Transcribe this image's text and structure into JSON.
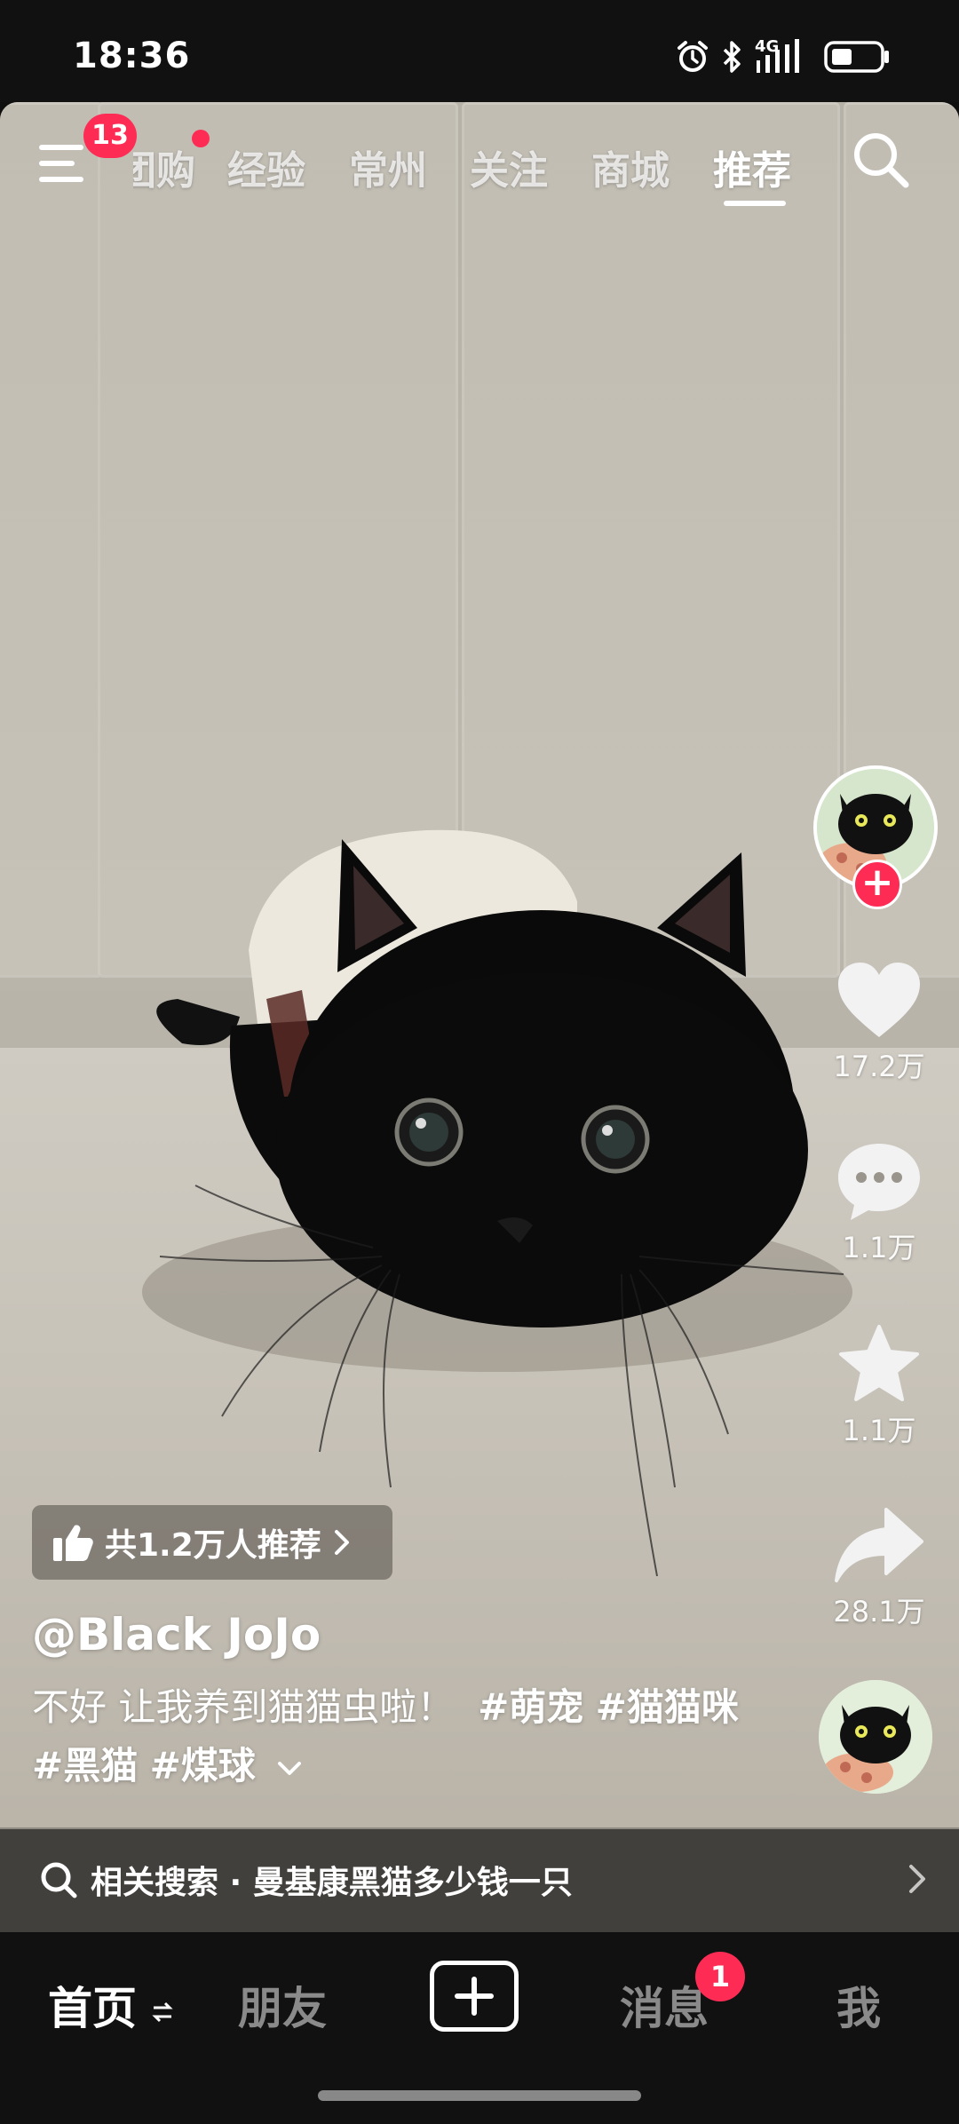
{
  "status_bar": {
    "time": "18:36",
    "network": "4G"
  },
  "top_nav": {
    "menu_badge": "13",
    "tabs": [
      {
        "label": "团购",
        "active": false
      },
      {
        "label": "经验",
        "active": false
      },
      {
        "label": "常州",
        "active": false
      },
      {
        "label": "关注",
        "active": false
      },
      {
        "label": "商城",
        "active": false
      },
      {
        "label": "推荐",
        "active": true
      }
    ]
  },
  "right_rail": {
    "likes": "17.2万",
    "comments": "1.1万",
    "favorites": "1.1万",
    "shares": "28.1万",
    "follow_symbol": "+"
  },
  "video": {
    "recommend_text": "共1.2万人推荐",
    "author": "@Black JoJo",
    "description": "不好 让我养到猫猫虫啦！",
    "hashtags": [
      "#萌宠",
      "#猫猫咪",
      "#黑猫",
      "#煤球"
    ]
  },
  "related_search": {
    "text": "相关搜索 · 曼基康黑猫多少钱一只"
  },
  "bottom_nav": {
    "items": [
      {
        "label": "首页",
        "active": true
      },
      {
        "label": "朋友",
        "active": false
      },
      {
        "label": "消息",
        "active": false
      },
      {
        "label": "我",
        "active": false
      }
    ],
    "message_badge": "1"
  },
  "colors": {
    "accent": "#fe2c55",
    "nav_bg": "#111111"
  }
}
